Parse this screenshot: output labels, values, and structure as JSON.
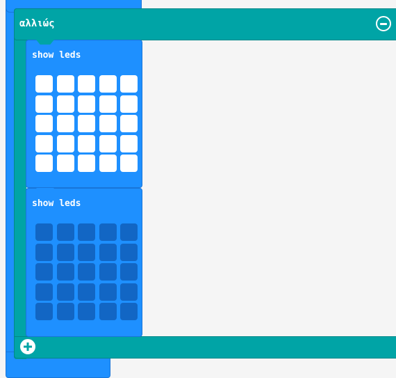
{
  "else_block": {
    "label": "αλλιώς",
    "color": "#00a4a6",
    "remove_icon": "minus-circle-icon",
    "add_icon": "plus-circle-icon"
  },
  "blocks": [
    {
      "title": "show leds",
      "color": "#1e90ff",
      "leds": [
        [
          1,
          1,
          1,
          1,
          1
        ],
        [
          1,
          1,
          1,
          1,
          1
        ],
        [
          1,
          1,
          1,
          1,
          1
        ],
        [
          1,
          1,
          1,
          1,
          1
        ],
        [
          1,
          1,
          1,
          1,
          1
        ]
      ]
    },
    {
      "title": "show leds",
      "color": "#1e90ff",
      "leds": [
        [
          0,
          0,
          0,
          0,
          0
        ],
        [
          0,
          0,
          0,
          0,
          0
        ],
        [
          0,
          0,
          0,
          0,
          0
        ],
        [
          0,
          0,
          0,
          0,
          0
        ],
        [
          0,
          0,
          0,
          0,
          0
        ]
      ]
    }
  ]
}
